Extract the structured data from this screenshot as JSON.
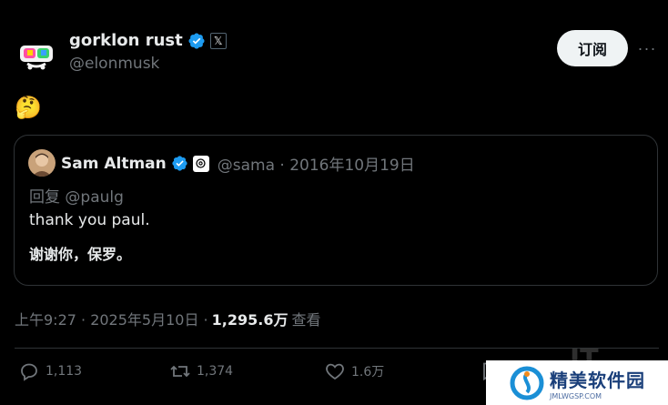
{
  "header": {
    "display_name": "gorklon rust",
    "handle": "@elonmusk",
    "x_badge": "𝕏",
    "subscribe_label": "订阅",
    "more_label": "···"
  },
  "post": {
    "text": "🤔"
  },
  "quote": {
    "name": "Sam Altman",
    "meta": "@sama · 2016年10月19日",
    "reply_to": "回复 @paulg",
    "text": "thank you paul.",
    "translation": "谢谢你，保罗。"
  },
  "timestamp": {
    "time_date": "上午9:27 · 2025年5月10日 ·",
    "views": "1,295.6万",
    "views_label": "查看"
  },
  "actions": {
    "replies": "1,113",
    "reposts": "1,374",
    "likes": "1.6万"
  },
  "watermark": {
    "it_text": "IT",
    "logo_title": "精美软件园",
    "logo_sub": "JMLWGSP.COM"
  },
  "colors": {
    "background": "#000000",
    "verified_blue": "#1d9bf0",
    "muted": "#71767b",
    "text": "#e7e9ea"
  }
}
